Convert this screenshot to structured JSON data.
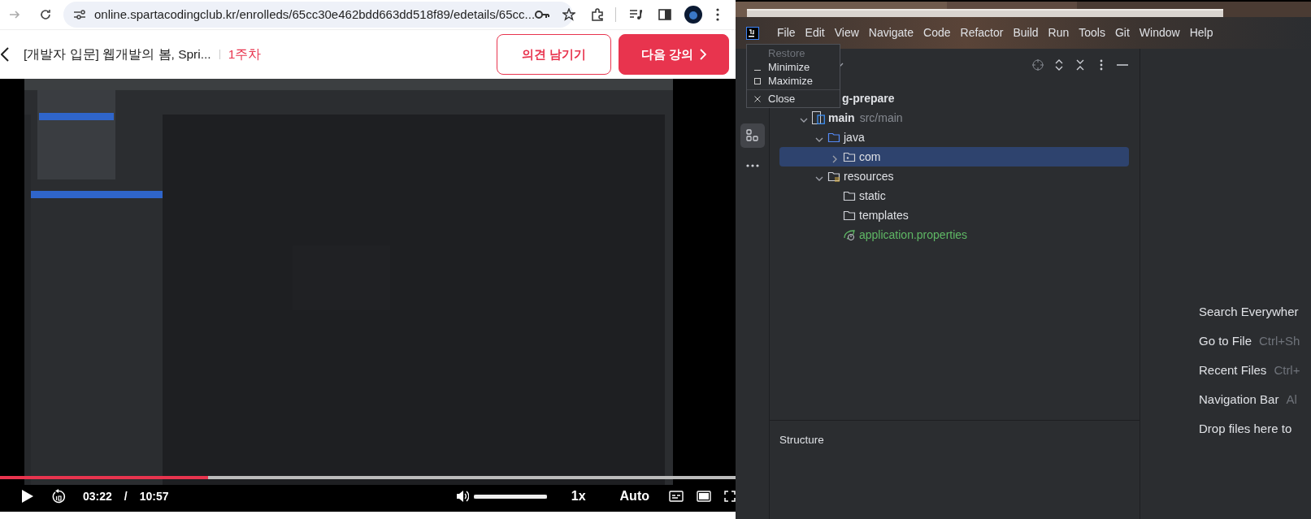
{
  "browser": {
    "url": "online.spartacodingclub.kr/enrolleds/65cc30e462bdd663dd518f89/edetails/65cc..."
  },
  "course_header": {
    "title": "[개발자 입문] 웹개발의 봄, Spri...",
    "week": "1주차",
    "buttons": [
      {
        "label": "의견 남기기",
        "kind": "outline"
      },
      {
        "label": "다음 강의",
        "kind": "primary"
      }
    ]
  },
  "video": {
    "kind": "picture",
    "progress": {
      "level": 0.283
    },
    "current_time": "03:22",
    "separator": "/",
    "duration": "10:57",
    "volume": {
      "level": 1.0
    },
    "speed": "1x",
    "quality": "Auto"
  },
  "ide": {
    "menu": [
      "File",
      "Edit",
      "View",
      "Navigate",
      "Code",
      "Refactor",
      "Build",
      "Run",
      "Tools",
      "Git",
      "Window",
      "Help"
    ],
    "window_menu": [
      {
        "label": "Restore",
        "kind": "restore",
        "disabled": true
      },
      {
        "label": "Minimize",
        "kind": "minimize",
        "disabled": false
      },
      {
        "label": "Maximize",
        "kind": "maximize",
        "disabled": false
      },
      {
        "label": "Close",
        "kind": "close",
        "disabled": false
      }
    ],
    "project_tree": [
      {
        "label": "g-prepare",
        "kind": "project",
        "selected": false,
        "children": [
          {
            "label": "main",
            "hint": "src/main",
            "kind": "module",
            "expanded": true,
            "selected": false,
            "children": [
              {
                "label": "java",
                "kind": "source",
                "expanded": true,
                "selected": false,
                "children": [
                  {
                    "label": "com",
                    "kind": "package",
                    "expanded": false,
                    "selected": true
                  }
                ]
              },
              {
                "label": "resources",
                "kind": "resources",
                "expanded": true,
                "selected": false,
                "children": [
                  {
                    "label": "static",
                    "kind": "folder",
                    "selected": false
                  },
                  {
                    "label": "templates",
                    "kind": "folder",
                    "selected": false
                  },
                  {
                    "label": "application.properties",
                    "kind": "properties",
                    "selected": false
                  }
                ]
              }
            ]
          }
        ]
      }
    ],
    "structure": {
      "title": "Structure"
    },
    "welcome": [
      {
        "action": "Search Everywher"
      },
      {
        "action": "Go to File",
        "shortcut": "Ctrl+Sh"
      },
      {
        "action": "Recent Files",
        "shortcut": "Ctrl+"
      },
      {
        "action": "Navigation Bar",
        "shortcut": "Al"
      },
      {
        "action": "Drop files here to"
      }
    ]
  }
}
